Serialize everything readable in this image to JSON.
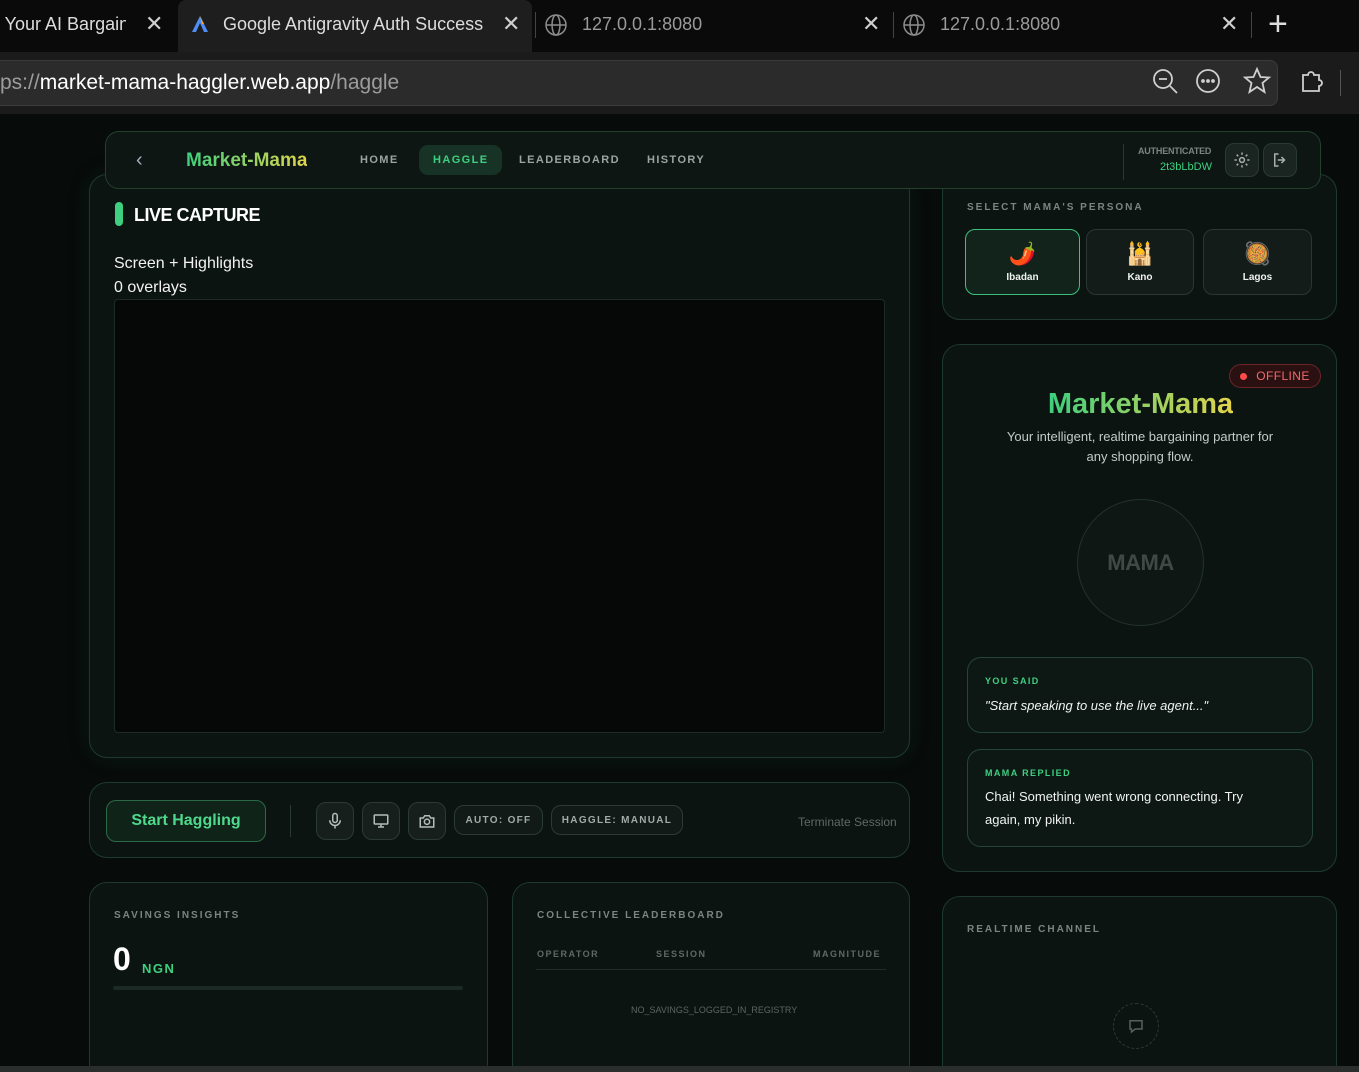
{
  "browser": {
    "tabs": [
      {
        "title": "- Your AI Bargainin",
        "active": false
      },
      {
        "title": "Google Antigravity Auth Success",
        "active": true
      },
      {
        "title": "127.0.0.1:8080",
        "active": false
      },
      {
        "title": "127.0.0.1:8080",
        "active": false
      }
    ],
    "close_glyph": "✕",
    "new_tab_glyph": "+",
    "url_scheme": "ps://",
    "url_host": "market-mama-haggler.web.app",
    "url_path": "/haggle"
  },
  "nav": {
    "back_glyph": "‹",
    "brand": "Market-Mama",
    "links": [
      "HOME",
      "HAGGLE",
      "LEADERBOARD",
      "HISTORY"
    ],
    "active_link": "HAGGLE",
    "auth_label": "AUTHENTICATED",
    "auth_id": "2t3bLbDW"
  },
  "live_capture": {
    "title": "LIVE CAPTURE",
    "mode": "Screen + Highlights",
    "overlays": "0 overlays"
  },
  "controls": {
    "start_label": "Start Haggling",
    "auto_label": "AUTO: OFF",
    "haggle_label": "HAGGLE: MANUAL",
    "terminate_label": "Terminate Session"
  },
  "savings": {
    "label": "SAVINGS INSIGHTS",
    "amount": "0",
    "currency": "NGN",
    "progress": 0
  },
  "leaderboard": {
    "label": "COLLECTIVE LEADERBOARD",
    "columns": [
      "OPERATOR",
      "SESSION",
      "MAGNITUDE"
    ],
    "empty": "NO_SAVINGS_LOGGED_IN_REGISTRY"
  },
  "persona": {
    "label": "SELECT MAMA'S PERSONA",
    "options": [
      {
        "name": "Ibadan",
        "icon": "🌶️",
        "selected": true
      },
      {
        "name": "Kano",
        "icon": "🕌",
        "selected": false
      },
      {
        "name": "Lagos",
        "icon": "🥘",
        "selected": false
      }
    ]
  },
  "mama": {
    "status": "OFFLINE",
    "title": "Market-Mama",
    "tagline": "Your intelligent, realtime bargaining partner for any shopping flow.",
    "avatar_text": "MAMA",
    "you_said_label": "YOU SAID",
    "you_said": "\"Start speaking to use the live agent...\"",
    "mama_replied_label": "MAMA REPLIED",
    "mama_replied": "Chai! Something went wrong connecting. Try again, my pikin."
  },
  "realtime": {
    "label": "REALTIME CHANNEL"
  },
  "colors": {
    "accent": "#3fcf80",
    "brand_gradient_end": "#e0d44b",
    "offline": "#ff4b4b",
    "background": "#070b0a"
  }
}
